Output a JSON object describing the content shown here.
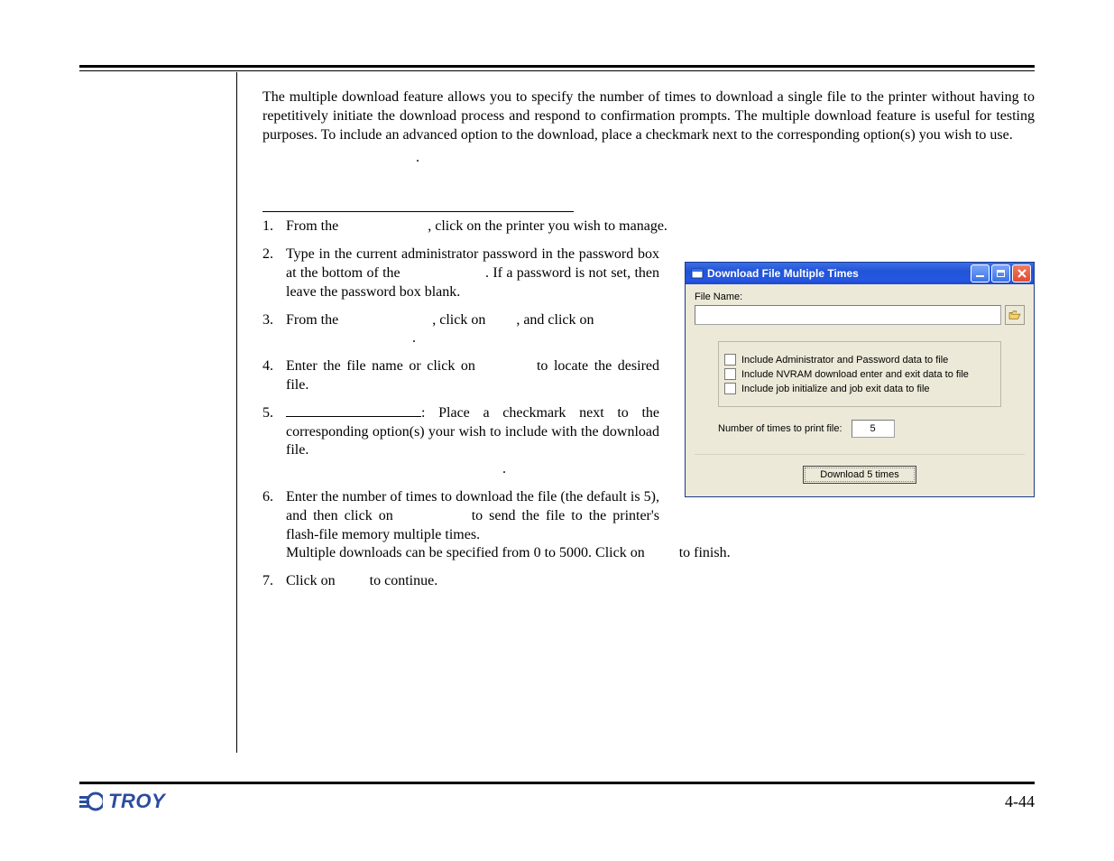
{
  "intro": "The multiple download feature allows you to specify the number of times to download a single file to the printer without having to repetitively initiate the download process and respond to confirmation prompts.  The multiple download feature is useful for testing purposes.  To include an advanced option to the download, place a checkmark next to the corresponding option(s) you wish to use.",
  "steps": {
    "s1": {
      "num": "1.",
      "a": "From the ",
      "b": ", click on the printer you wish to manage."
    },
    "s2": {
      "num": "2.",
      "a": "Type in the current administrator password in the password box at the bottom of the ",
      "b": ".  If a password is not set, then leave the password box blank."
    },
    "s3": {
      "num": "3.",
      "a": "From the ",
      "b": ", click on ",
      "c": ", and click on ",
      "d": "."
    },
    "s4": {
      "num": "4.",
      "a": "Enter the file name or click on ",
      "b": " to locate the desired file."
    },
    "s5": {
      "num": "5.",
      "a": ": Place a checkmark next to the corresponding option(s) your wish to include with the download file.",
      "b": "."
    },
    "s6": {
      "num": "6.",
      "a": "Enter the number of times to download the file (the default is 5), and then click on ",
      "b": " to send the file to the printer's flash-file memory multiple times.  Multiple downloads can be specified from 0 to 5000.  Click on ",
      "c": " to finish."
    },
    "s7": {
      "num": "7.",
      "a": "Click on ",
      "b": " to continue."
    }
  },
  "dialog": {
    "title": "Download File Multiple Times",
    "file_name_label": "File Name:",
    "file_name_value": "",
    "options": {
      "o1": "Include Administrator and Password data to file",
      "o2": "Include NVRAM download enter and exit data to file",
      "o3": "Include job initialize and job exit data to file"
    },
    "num_label": "Number of times to print file:",
    "num_value": "5",
    "download_button": "Download 5 times"
  },
  "footer": {
    "brand": "TROY",
    "page": "4-44"
  }
}
